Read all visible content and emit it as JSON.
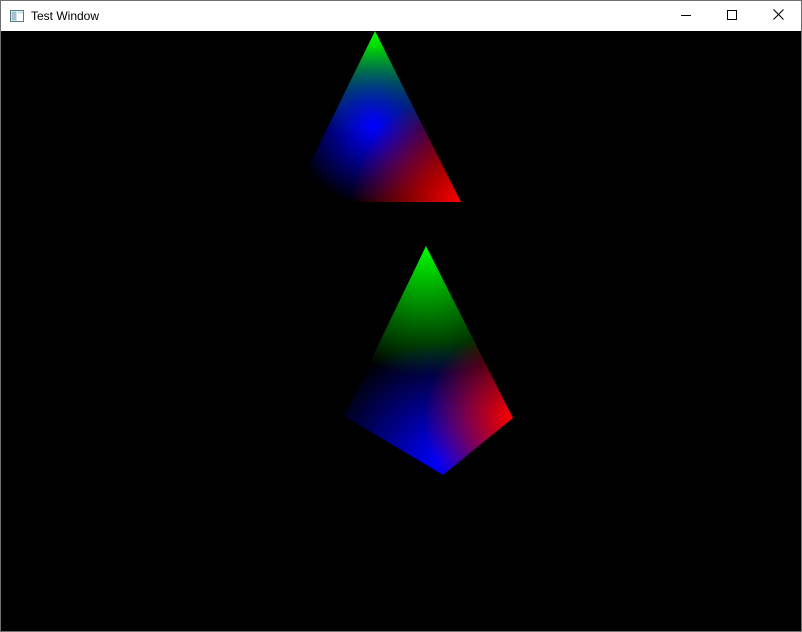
{
  "window": {
    "title": "Test Window",
    "app_icon": "window-icon",
    "controls": {
      "minimize_icon": "minimize-icon",
      "maximize_icon": "maximize-icon",
      "close_icon": "close-icon"
    }
  },
  "viewport": {
    "background": "#000000"
  },
  "colors": {
    "vertex_red": "#ff0000",
    "vertex_green": "#00ff00",
    "vertex_blue": "#0000ff",
    "vertex_black": "#000000",
    "close_hover": "#e81123"
  }
}
